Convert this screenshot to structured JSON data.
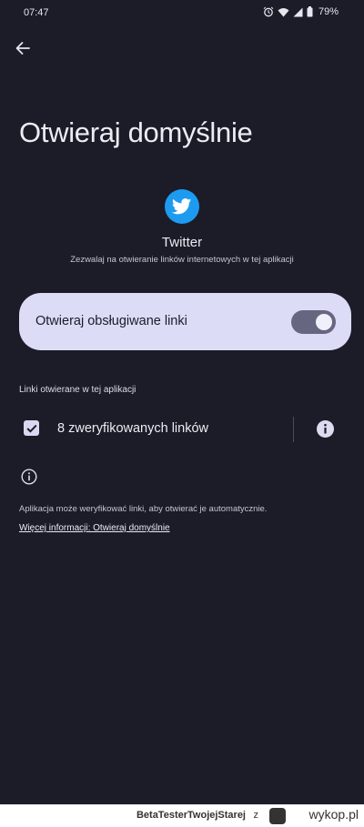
{
  "status_bar": {
    "time": "07:47",
    "battery": "79%",
    "icons": [
      "alarm-icon",
      "wifi-icon",
      "signal-icon",
      "battery-icon"
    ]
  },
  "header": {
    "back_icon": "arrow-back-icon",
    "title": "Otwieraj domyślnie"
  },
  "app": {
    "icon": "twitter-bird-icon",
    "icon_color": "#1d9bf0",
    "name": "Twitter",
    "description": "Zezwalaj na otwieranie linków internetowych w tej aplikacji"
  },
  "toggle": {
    "label": "Otwieraj obsługiwane linki",
    "enabled": true,
    "card_color": "#dcdcf7"
  },
  "links_section": {
    "header": "Linki otwierane w tej aplikacji",
    "verified_links_label": "8 zweryfikowanych linków",
    "checked": true,
    "info_icon": "info-filled-icon"
  },
  "footer": {
    "info_icon": "info-outline-icon",
    "text": "Aplikacja może weryfikować linki, aby otwierać je automatycznie.",
    "link": "Więcej informacji: Otwieraj domyślnie"
  },
  "watermark": {
    "user": "BetaTesterTwojejStarej",
    "separator": "z",
    "site": "wykop.pl"
  },
  "colors": {
    "background": "#1b1c28",
    "switch_track": "#666680",
    "checkbox": "#d8d9f1"
  }
}
